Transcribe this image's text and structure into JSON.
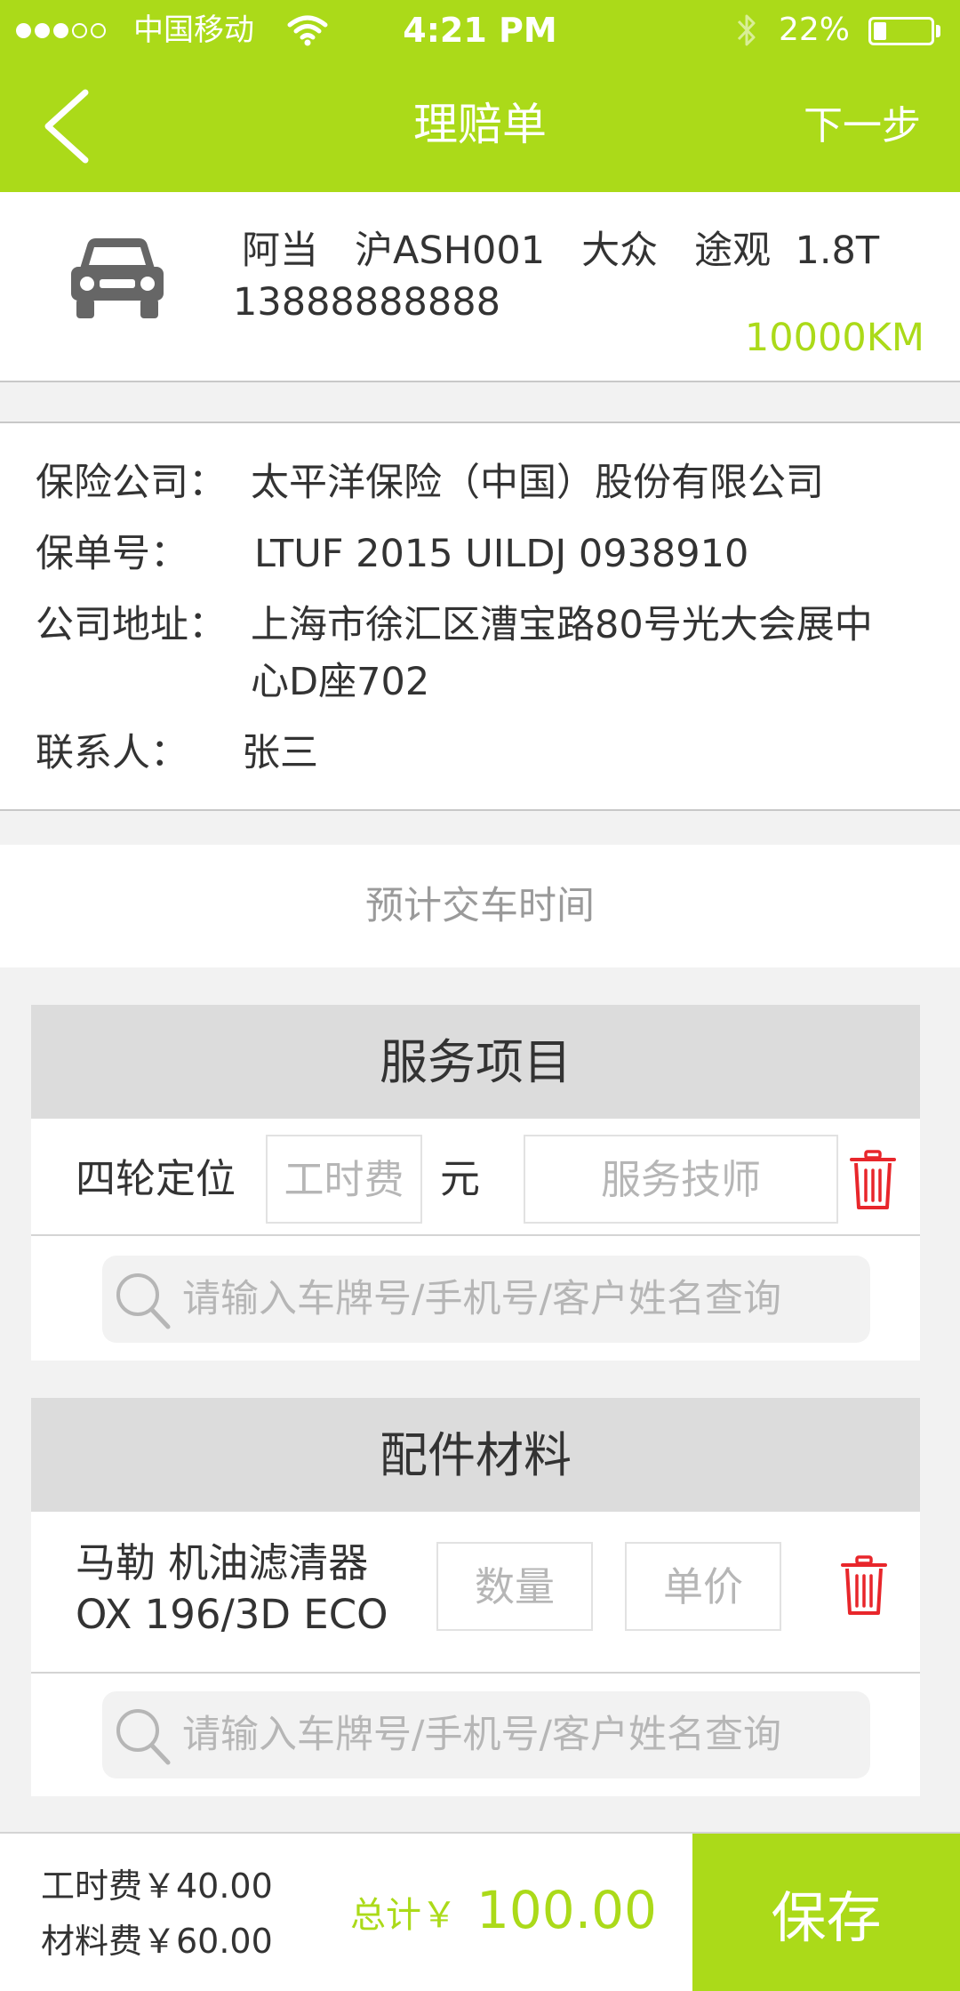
{
  "status_bar": {
    "carrier": "中国移动",
    "time": "4:21 PM",
    "battery_percent": "22%",
    "battery_level": 0.22,
    "signal_bars_filled": 3,
    "signal_bars_total": 5
  },
  "nav": {
    "title": "理赔单",
    "next_label": "下一步",
    "back_icon": "chevron-left-icon"
  },
  "vehicle": {
    "icon": "car-icon",
    "info_line": "阿当   沪ASH001   大众   途观  1.8T",
    "phone": "13888888888",
    "mileage": "10000KM"
  },
  "insurance": {
    "company_label": "保险公司：",
    "company_value": "太平洋保险（中国）股份有限公司",
    "policy_label": "保单号：",
    "policy_value": "LTUF 2015 UILDJ 0938910",
    "address_label": "公司地址：",
    "address_value": "上海市徐汇区漕宝路80号光大会展中心D座702",
    "contact_label": "联系人：",
    "contact_value": "张三"
  },
  "delivery": {
    "label": "预计交车时间"
  },
  "services": {
    "title": "服务项目",
    "item_name": "四轮定位",
    "labor_placeholder": "工时费",
    "unit": "元",
    "technician_placeholder": "服务技师",
    "search_placeholder": "请输入车牌号/手机号/客户姓名查询"
  },
  "parts": {
    "title": "配件材料",
    "item_name_line1": "马勒 机油滤清器",
    "item_name_line2": "OX 196/3D ECO",
    "quantity_placeholder": "数量",
    "price_placeholder": "单价",
    "search_placeholder": "请输入车牌号/手机号/客户姓名查询"
  },
  "footer": {
    "labor_fee": "工时费￥40.00",
    "material_fee": "材料费￥60.00",
    "total_label": "总计￥",
    "total_value": "100.00",
    "save_label": "保存"
  },
  "colors": {
    "accent": "#abda19",
    "delete": "#e8262b",
    "section_header": "#dcdcdc",
    "page_background": "#f2f2f2"
  }
}
